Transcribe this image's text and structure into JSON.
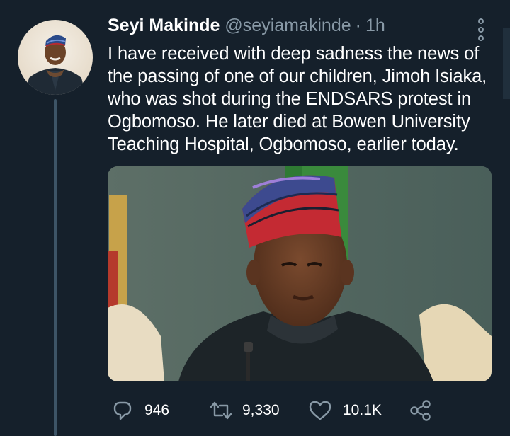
{
  "tweet": {
    "author_name": "Seyi Makinde",
    "author_handle": "@seyiamakinde",
    "separator": "·",
    "time": "1h",
    "text": "I have received with deep sadness the news of the passing of one of our children, Jimoh Isiaka, who was shot during the ENDSARS protest in Ogbomoso. He later died at Bowen University Teaching Hospital, Ogbomoso, earlier today."
  },
  "actions": {
    "reply_icon": "reply-icon",
    "reply_count": "946",
    "retweet_icon": "retweet-icon",
    "retweet_count": "9,330",
    "like_icon": "heart-icon",
    "like_count": "10.1K",
    "share_icon": "share-icon"
  },
  "colors": {
    "background": "#15202b",
    "secondary_text": "#8899a6",
    "thread_line": "#3d5466"
  }
}
